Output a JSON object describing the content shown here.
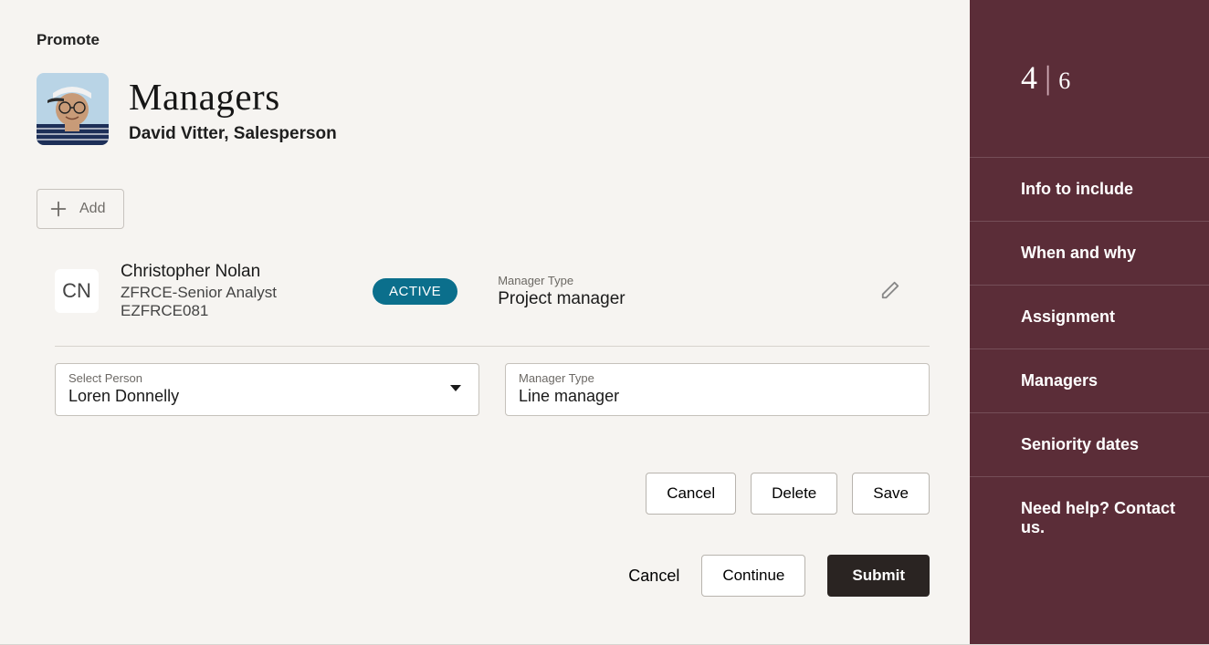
{
  "breadcrumb": "Promote",
  "page": {
    "title": "Managers",
    "person_name": "David Vitter",
    "person_role": "Salesperson"
  },
  "toolbar": {
    "add_label": "Add"
  },
  "current_manager": {
    "initials": "CN",
    "name": "Christopher Nolan",
    "role": "ZFRCE-Senior Analyst",
    "code": "EZFRCE081",
    "status": "ACTIVE",
    "type_label": "Manager Type",
    "type_value": "Project manager"
  },
  "editing": {
    "person_label": "Select Person",
    "person_value": "Loren Donnelly",
    "type_label": "Manager Type",
    "type_value": "Line manager"
  },
  "card_actions": {
    "cancel": "Cancel",
    "delete": "Delete",
    "save": "Save"
  },
  "footer": {
    "cancel": "Cancel",
    "continue": "Continue",
    "submit": "Submit"
  },
  "progress": {
    "current": "4",
    "total": "6"
  },
  "steps": [
    {
      "label": "Info to include"
    },
    {
      "label": "When and why"
    },
    {
      "label": "Assignment"
    },
    {
      "label": "Managers",
      "active": true
    },
    {
      "label": "Seniority dates"
    },
    {
      "label": "Need help? Contact us.",
      "help": true
    }
  ]
}
